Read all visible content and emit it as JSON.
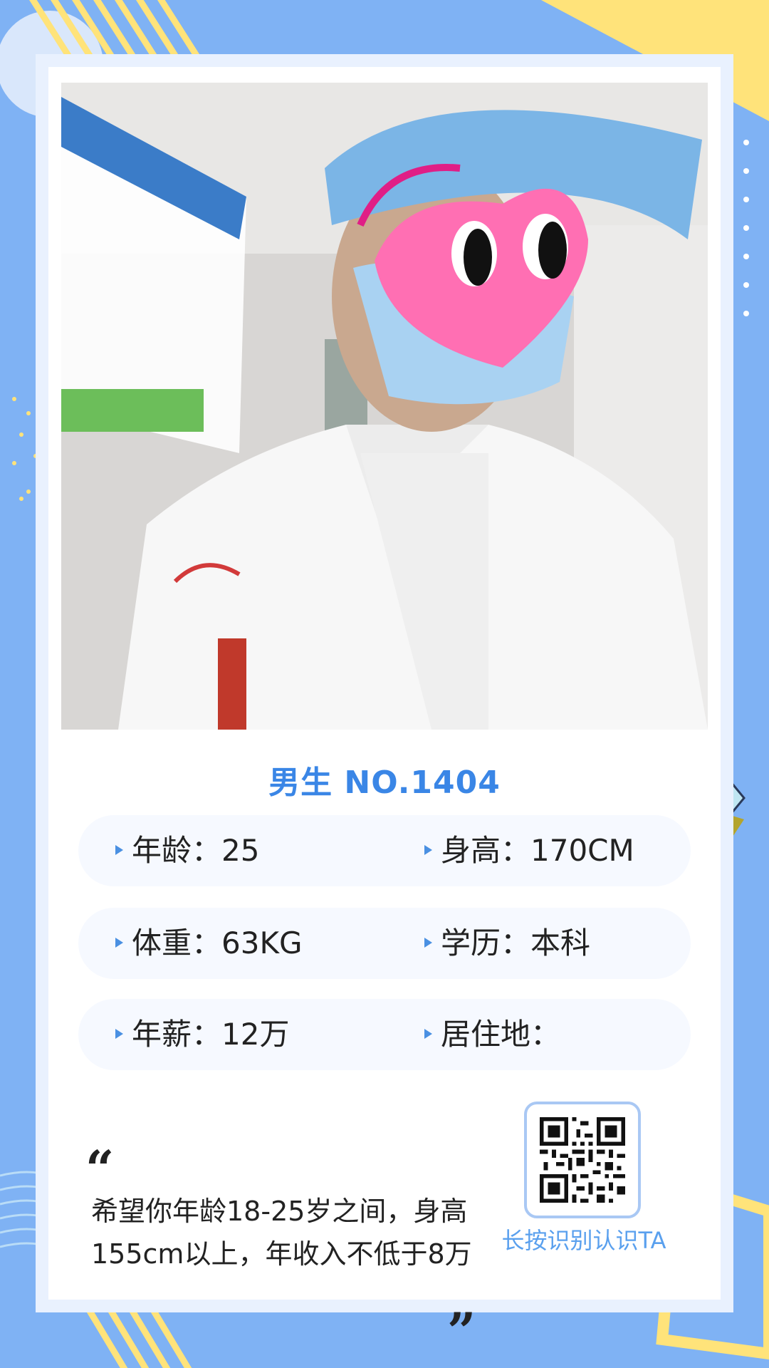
{
  "colors": {
    "background": "#7fb2f4",
    "accent": "#3a86e6",
    "yellow": "#ffe37a",
    "row_bg": "#f6f9ff",
    "caption": "#5aa0ee"
  },
  "profile": {
    "title": "男生 NO.1404",
    "photo_description_icon": "profile-photo",
    "info": [
      [
        {
          "label": "年龄：25"
        },
        {
          "label": "身高：170CM"
        }
      ],
      [
        {
          "label": "体重：63KG"
        },
        {
          "label": "学历：本科"
        }
      ],
      [
        {
          "label": "年薪：12万"
        },
        {
          "label": "居住地："
        }
      ]
    ],
    "quote_open": "“",
    "quote_close": "”",
    "wish_text": "希望你年龄18-25岁之间，身高155cm以上，年收入不低于8万"
  },
  "qr": {
    "icon": "qr-code-icon",
    "caption": "长按识别认识TA"
  }
}
